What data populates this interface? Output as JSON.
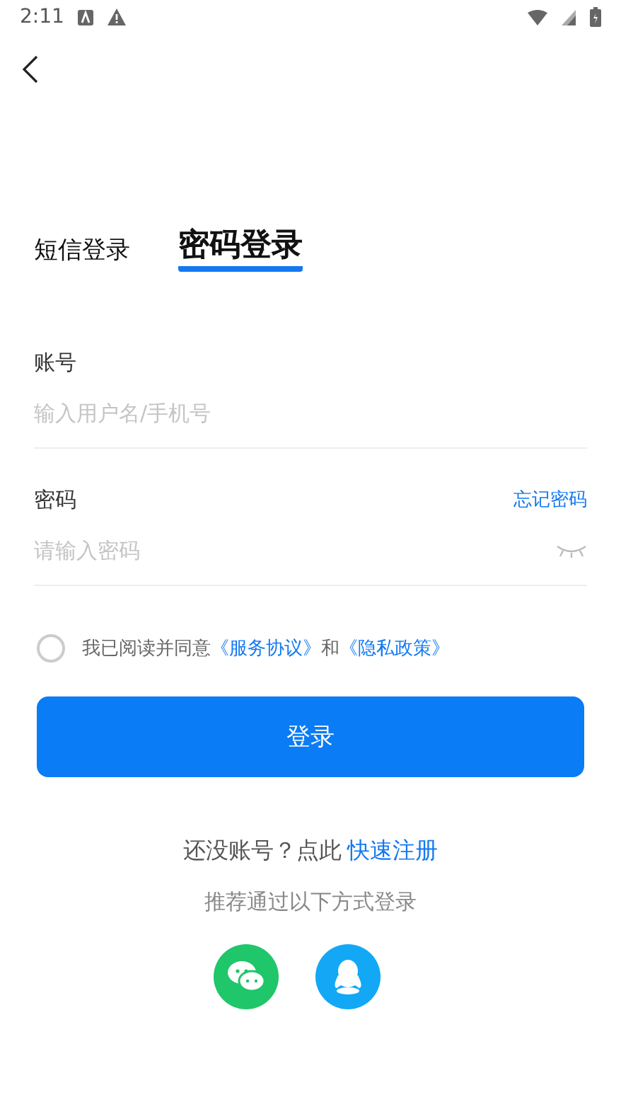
{
  "status_bar": {
    "time": "2:11"
  },
  "tabs": [
    {
      "label": "短信登录",
      "selected": false
    },
    {
      "label": "密码登录",
      "selected": true
    }
  ],
  "fields": [
    {
      "label": "账号",
      "placeholder": "输入用户名/手机号"
    },
    {
      "label": "密码",
      "placeholder": "请输入密码",
      "link": "忘记密码",
      "kind": "password"
    }
  ],
  "agreement": {
    "checked": false,
    "text": "我已阅读并同意",
    "terms": "《服务协议》",
    "and": "和",
    "privacy": "《隐私政策》"
  },
  "login_button": "登录",
  "register": {
    "prompt": "还没账号？点此",
    "link": "快速注册"
  },
  "alt_login": {
    "title": "推荐通过以下方式登录",
    "options": [
      {
        "kind": "wechat"
      },
      {
        "kind": "qq"
      }
    ]
  }
}
